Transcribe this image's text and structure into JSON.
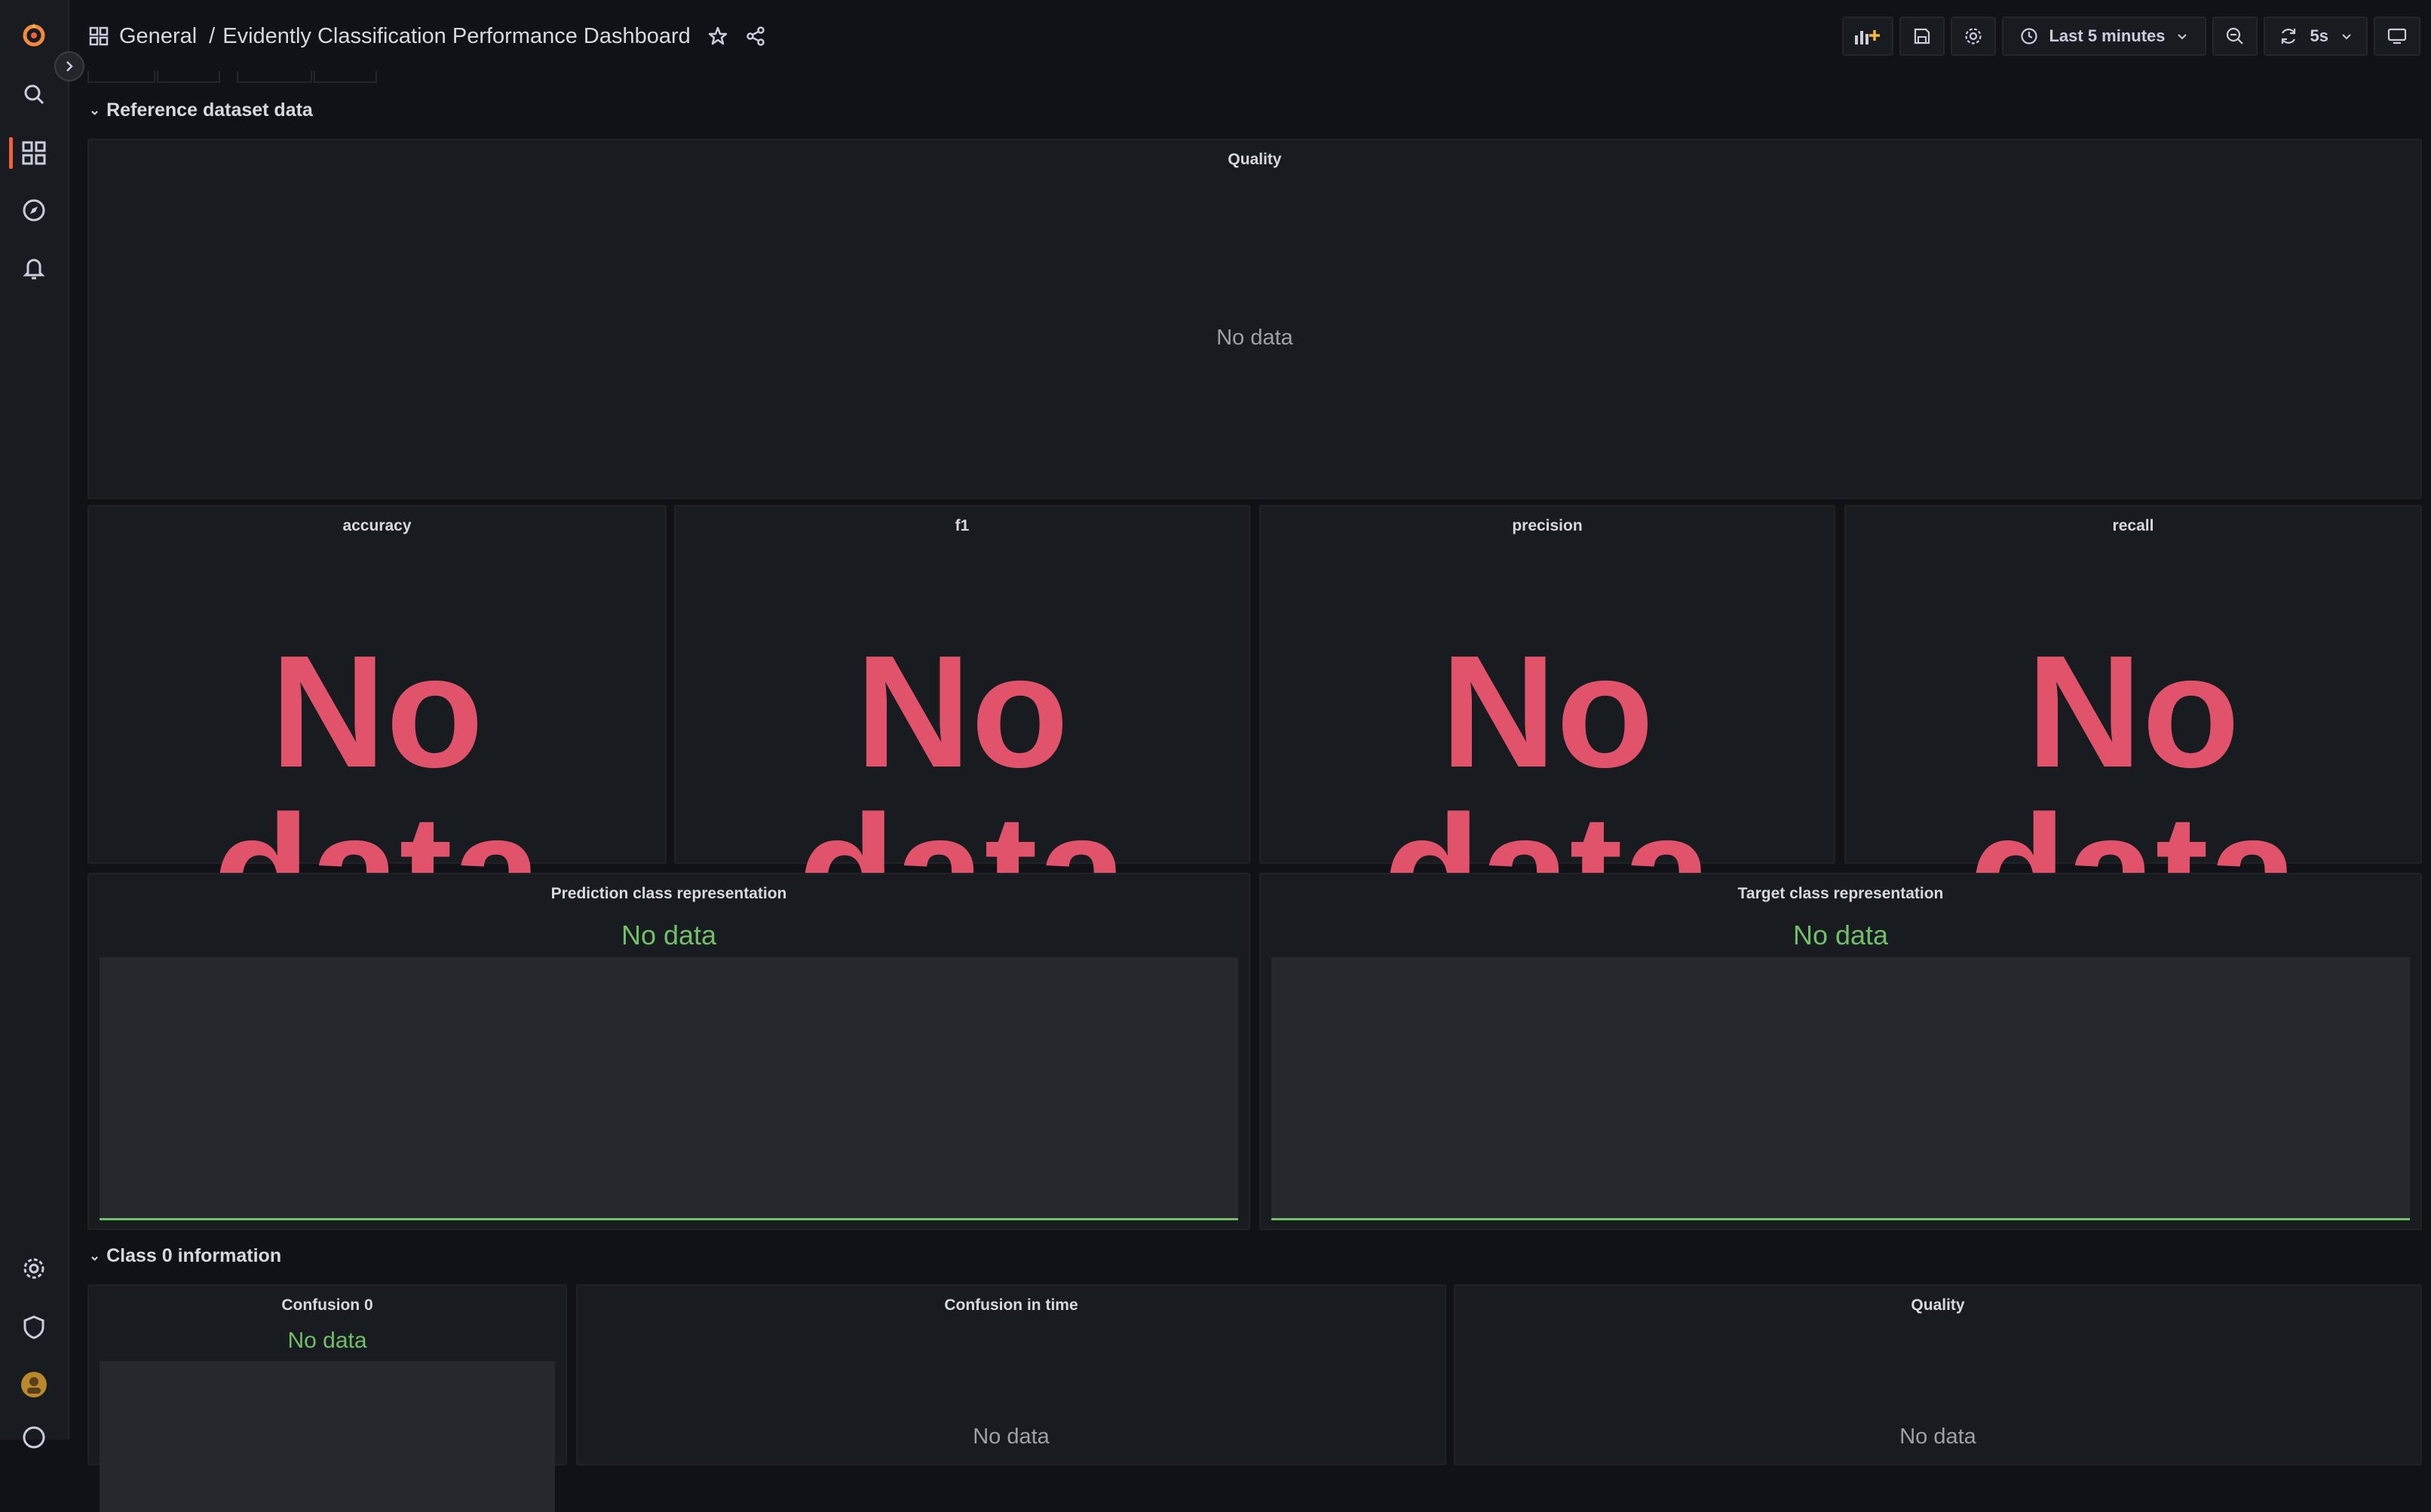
{
  "breadcrumb": {
    "folder": "General",
    "title": "Evidently Classification Performance Dashboard"
  },
  "toolbar": {
    "time_range": "Last 5 minutes",
    "refresh_interval": "5s"
  },
  "rows": [
    {
      "title": "Reference dataset data"
    },
    {
      "title": "Class 0 information"
    }
  ],
  "panels": {
    "quality_ref": {
      "title": "Quality",
      "message": "No data"
    },
    "accuracy": {
      "title": "accuracy",
      "message": "No data"
    },
    "f1": {
      "title": "f1",
      "message": "No data"
    },
    "precision": {
      "title": "precision",
      "message": "No data"
    },
    "recall": {
      "title": "recall",
      "message": "No data"
    },
    "prediction_class": {
      "title": "Prediction class representation",
      "message": "No data"
    },
    "target_class": {
      "title": "Target class representation",
      "message": "No data"
    },
    "confusion0": {
      "title": "Confusion 0",
      "message": "No data"
    },
    "confusion_time": {
      "title": "Confusion in time",
      "message": "No data"
    },
    "quality_class0": {
      "title": "Quality",
      "message": "No data"
    }
  },
  "icons": [
    "grafana-logo-icon",
    "search-icon",
    "dashboards-icon",
    "explore-icon",
    "alerting-icon",
    "configuration-icon",
    "server-admin-icon",
    "user-avatar-icon",
    "help-icon",
    "star-icon",
    "share-icon",
    "add-panel-icon",
    "save-icon",
    "settings-icon",
    "clock-icon",
    "zoom-out-icon",
    "refresh-icon",
    "tv-mode-icon"
  ],
  "colors": {
    "accent": "#f55f3e",
    "nodata_red": "#e0536a",
    "nodata_green": "#73bf69",
    "background": "#111217",
    "panel": "#181b1f"
  }
}
